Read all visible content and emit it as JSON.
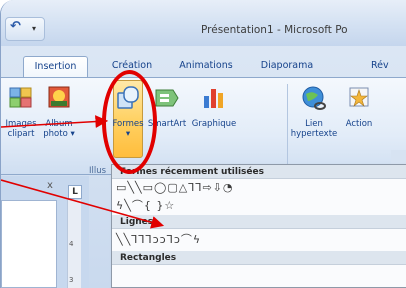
{
  "title_bar": {
    "title": "Présentation1 - Microsoft Po",
    "undo_glyph": "↶",
    "qat_arrow": "▾"
  },
  "tabs": [
    {
      "label": "Insertion",
      "active": true
    },
    {
      "label": "Création",
      "active": false
    },
    {
      "label": "Animations",
      "active": false
    },
    {
      "label": "Diaporama",
      "active": false
    },
    {
      "label": "Rév",
      "active": false
    }
  ],
  "ribbon": {
    "buttons": {
      "images_clipart": [
        "Images",
        "clipart"
      ],
      "album_photo": [
        "Album",
        "photo ▾"
      ],
      "formes": [
        "Formes",
        "▾"
      ],
      "smartart": [
        "SmartArt"
      ],
      "graphique": [
        "Graphique"
      ],
      "lien_hypertexte": [
        "Lien",
        "hypertexte"
      ],
      "action": [
        "Action"
      ]
    },
    "group_illustrations": "Illus"
  },
  "left_pane": {
    "close": "x",
    "ruler_tab": "L",
    "ruler_numbers": [
      "4",
      "3"
    ]
  },
  "dropdown": {
    "section_recent": "Formes récemment utilisées",
    "recent_row1": "▭╲╲▭◯▢△⅂⅂⇨⇩◔",
    "recent_row2": "ϟ╲⌒{ }☆",
    "section_lines": "Lignes",
    "lines_row": "╲╲⅂⅂⅂ↄↄ⅂ↄ⌒ϟ",
    "section_next": "Rectangles"
  },
  "colors": {
    "annotation_red": "#e10000",
    "accent_blue": "#15428b"
  }
}
